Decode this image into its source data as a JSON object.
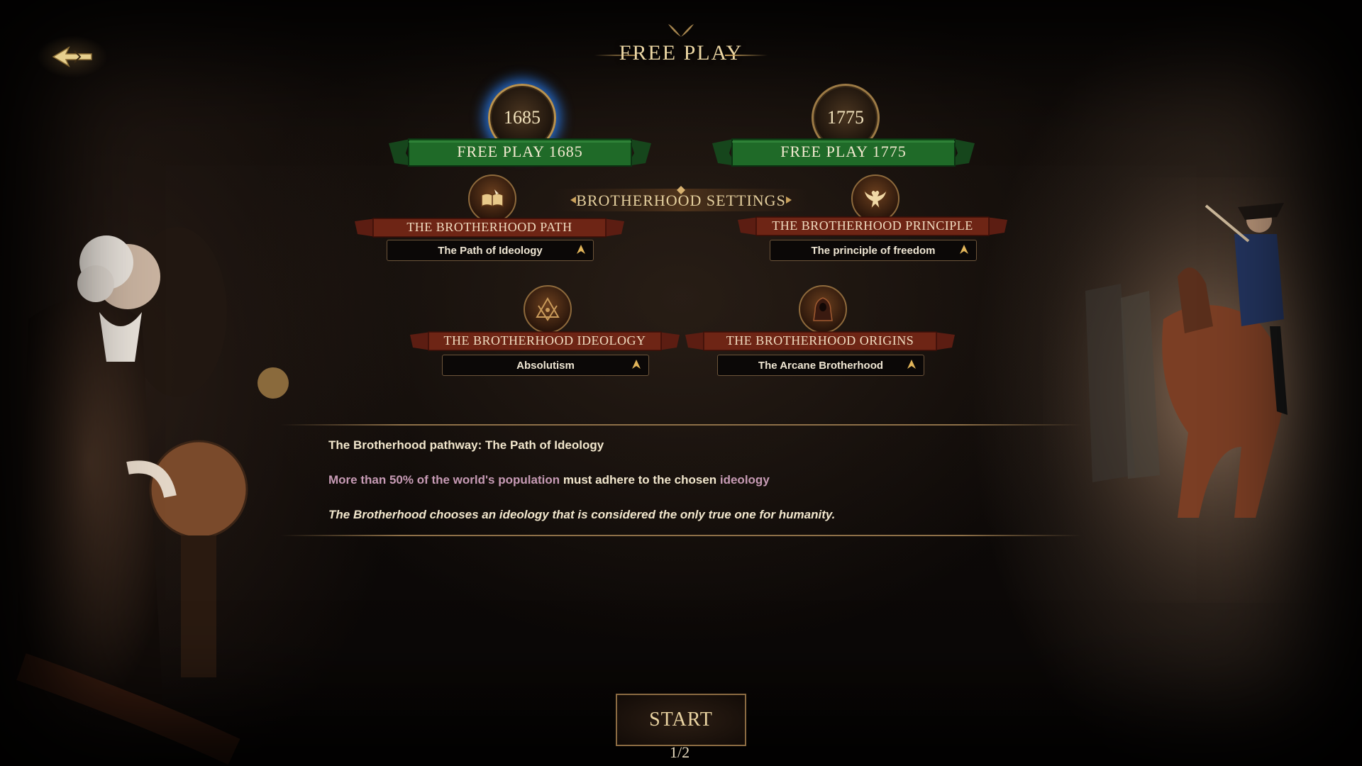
{
  "header": {
    "title": "FREE PLAY"
  },
  "eras": [
    {
      "year": "1685",
      "label": "FREE PLAY 1685",
      "selected": true
    },
    {
      "year": "1775",
      "label": "FREE PLAY 1775",
      "selected": false
    }
  ],
  "settings_title": "BROTHERHOOD SETTINGS",
  "settings": [
    {
      "title": "THE BROTHERHOOD PATH",
      "value": "The Path of Ideology",
      "icon": "book-icon"
    },
    {
      "title": "THE BROTHERHOOD PRINCIPLE",
      "value": "The principle of freedom",
      "icon": "eagle-icon"
    },
    {
      "title": "THE BROTHERHOOD IDEOLOGY",
      "value": "Absolutism",
      "icon": "compass-square-icon"
    },
    {
      "title": "THE BROTHERHOOD ORIGINS",
      "value": "The Arcane Brotherhood",
      "icon": "hooded-figure-icon"
    }
  ],
  "description": {
    "line1": "The Brotherhood pathway: The Path of Ideology",
    "line2_a": "More than 50% of the world's population",
    "line2_b": " must adhere to the chosen ",
    "line2_c": "ideology",
    "line3_a": "The Brotherhood chooses an ",
    "line3_b": "ideology",
    "line3_c": " that is considered the only true one for humanity."
  },
  "start_label": "START",
  "pager": {
    "current": "1",
    "separator": "/",
    "total": "2"
  },
  "colors": {
    "accent_gold": "#c9a15c",
    "banner_green": "#1f5a24",
    "banner_red": "#6b2416",
    "highlight": "#c79bb5",
    "selected_glow": "#2878e6"
  }
}
